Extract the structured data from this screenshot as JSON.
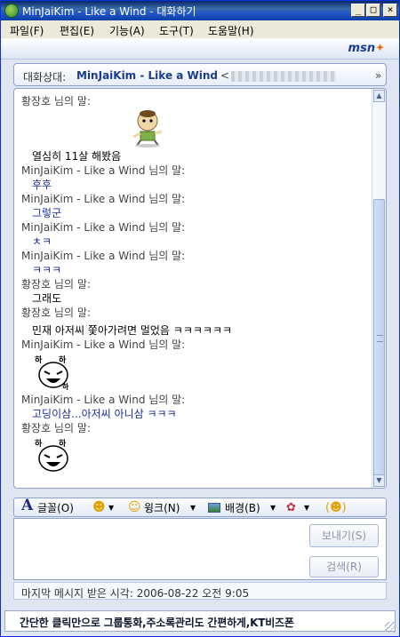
{
  "window": {
    "title": "MinJaiKim - Like a Wind - 대화하기",
    "min": "_",
    "max": "□",
    "close": "×"
  },
  "menu": [
    "파일(F)",
    "편집(E)",
    "기능(A)",
    "도구(T)",
    "도움말(H)"
  ],
  "brand": {
    "logo_text": "msn"
  },
  "to_bar": {
    "label": "대화상대:",
    "contact": "MinJaiKim - Like a Wind",
    "bracket": "<"
  },
  "conversation": {
    "h1": "황장호 님의 말:",
    "m1": "열심히 11살 해봤음",
    "h2": "MinJaiKim - Like a Wind 님의 말:",
    "m2": "후후",
    "h3": "MinJaiKim - Like a Wind 님의 말:",
    "m3": "그렇군",
    "h4": "MinJaiKim - Like a Wind 님의 말:",
    "m4": "ㅊㅋ",
    "h5": "MinJaiKim - Like a Wind 님의 말:",
    "m5": "ㅋㅋㅋ",
    "h6": "황장호 님의 말:",
    "m6": "그래도",
    "h7": "황장호 님의 말:",
    "m7": "민재 아저씨 쫓아가려면 멀었음 ㅋㅋㅋㅋㅋㅋ",
    "h8": "MinJaiKim - Like a Wind 님의 말:",
    "h9": "MinJaiKim - Like a Wind 님의 말:",
    "m9": "고딩이삼...아저씨 아니삼 ㅋㅋㅋ",
    "h10": "황장호 님의 말:"
  },
  "toolbar": {
    "font": "글꼴(O)",
    "wink": "윙크(N)",
    "background": "배경(B)"
  },
  "buttons": {
    "send": "보내기(S)",
    "search": "검색(R)"
  },
  "status": "마지막 메시지 받은 시각: 2006-08-22 오전 9:05",
  "ad": "간단한 클릭만으로 그룹통화,주소록관리도 간편하게,KT비즈폰"
}
